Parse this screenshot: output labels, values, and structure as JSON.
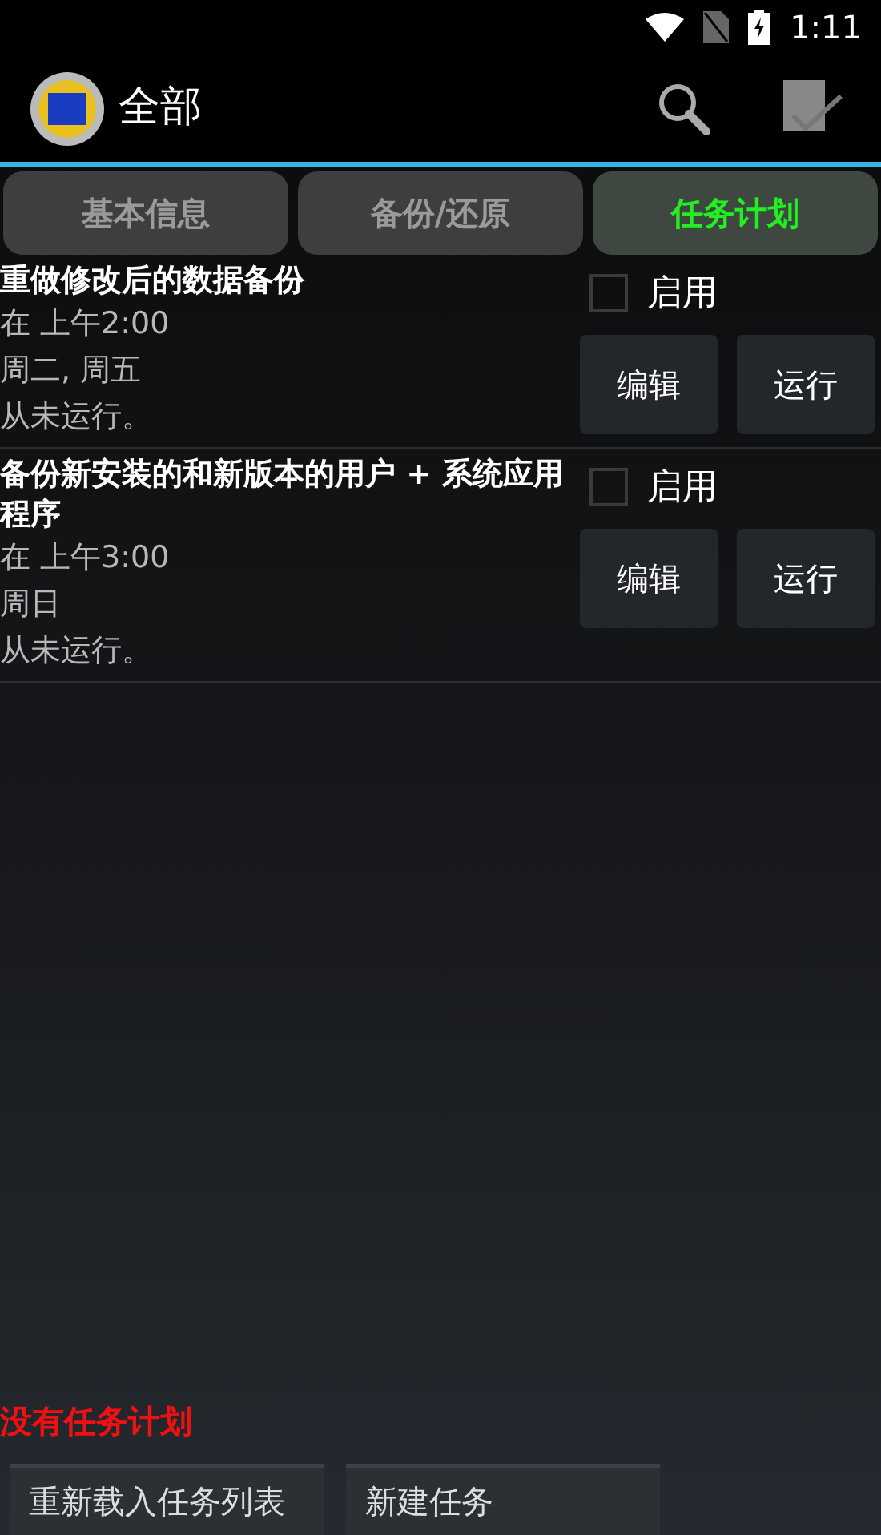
{
  "status_bar": {
    "time": "1:11"
  },
  "action_bar": {
    "title": "全部"
  },
  "tabs": [
    {
      "label": "基本信息",
      "selected": false
    },
    {
      "label": "备份/还原",
      "selected": false
    },
    {
      "label": "任务计划",
      "selected": true
    }
  ],
  "schedules": [
    {
      "title": "重做修改后的数据备份",
      "time": "在 上午2:00",
      "days": "周二, 周五",
      "last_run": "从未运行。",
      "enable_label": "启用",
      "checked": false,
      "edit": "编辑",
      "run": "运行"
    },
    {
      "title": "备份新安装的和新版本的用户 + 系统应用程序",
      "time": "在 上午3:00",
      "days": "周日",
      "last_run": "从未运行。",
      "enable_label": "启用",
      "checked": false,
      "edit": "编辑",
      "run": "运行"
    }
  ],
  "footer": {
    "message": "没有任务计划",
    "buttons": [
      "重新载入任务列表",
      "新建任务"
    ]
  }
}
